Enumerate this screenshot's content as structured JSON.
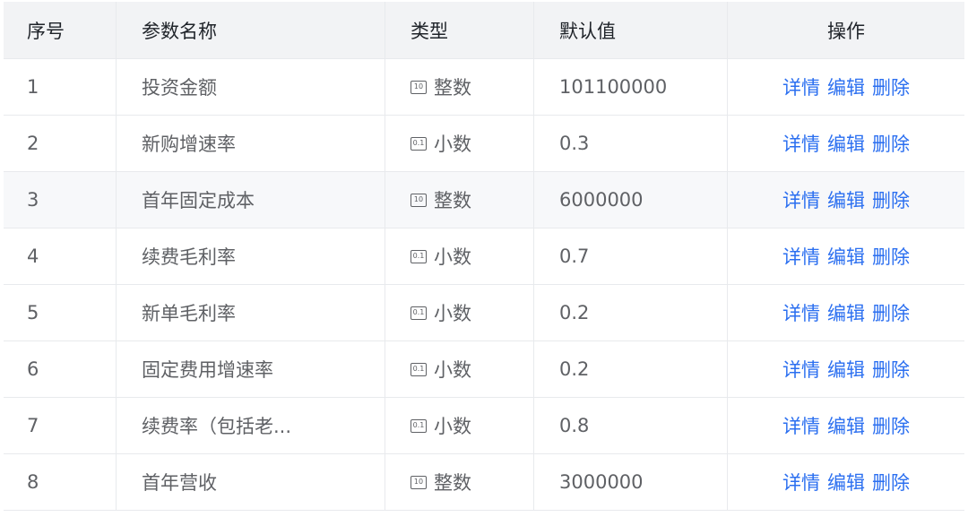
{
  "headers": {
    "index": "序号",
    "name": "参数名称",
    "type": "类型",
    "default": "默认值",
    "actions": "操作"
  },
  "rows": [
    {
      "index": "1",
      "name": "投资金额",
      "type_icon": "10",
      "type": "整数",
      "default": "101100000",
      "shaded": false
    },
    {
      "index": "2",
      "name": "新购增速率",
      "type_icon": "0.1",
      "type": "小数",
      "default": "0.3",
      "shaded": false
    },
    {
      "index": "3",
      "name": "首年固定成本",
      "type_icon": "10",
      "type": "整数",
      "default": "6000000",
      "shaded": true
    },
    {
      "index": "4",
      "name": "续费毛利率",
      "type_icon": "0.1",
      "type": "小数",
      "default": "0.7",
      "shaded": false
    },
    {
      "index": "5",
      "name": "新单毛利率",
      "type_icon": "0.1",
      "type": "小数",
      "default": "0.2",
      "shaded": false
    },
    {
      "index": "6",
      "name": "固定费用增速率",
      "type_icon": "0.1",
      "type": "小数",
      "default": "0.2",
      "shaded": false
    },
    {
      "index": "7",
      "name": "续费率（包括老...",
      "type_icon": "0.1",
      "type": "小数",
      "default": "0.8",
      "shaded": false
    },
    {
      "index": "8",
      "name": "首年营收",
      "type_icon": "10",
      "type": "整数",
      "default": "3000000",
      "shaded": false
    }
  ],
  "actions": {
    "detail": "详情",
    "edit": "编辑",
    "delete": "删除"
  },
  "colors": {
    "link": "#2b6ff0",
    "header_bg": "#f2f3f5",
    "shaded_row_bg": "#f7f8fa"
  }
}
